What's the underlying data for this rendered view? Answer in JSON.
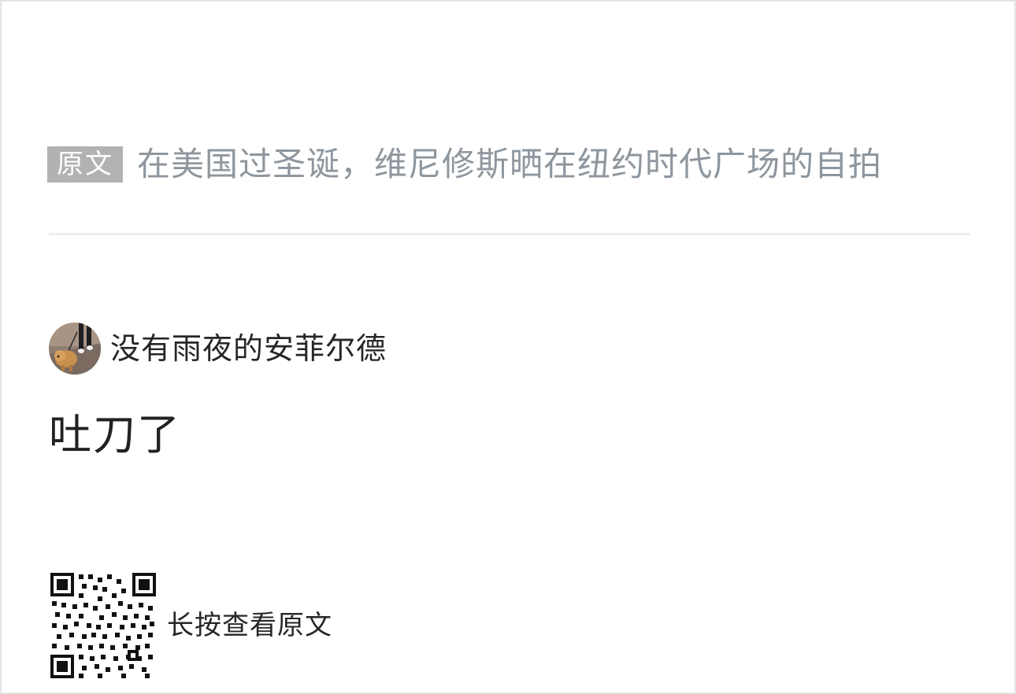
{
  "original": {
    "badge_label": "原文",
    "title": "在美国过圣诞，维尼修斯晒在纽约时代广场的自拍"
  },
  "author": {
    "name": "没有雨夜的安菲尔德",
    "avatar_icon": "dog-photo-avatar"
  },
  "comment": {
    "text": "吐刀了"
  },
  "qr": {
    "icon": "qr-code-icon",
    "hint": "长按查看原文"
  },
  "colors": {
    "badge_bg": "#b2b2b2",
    "title_text": "#8e969e",
    "body_text": "#222222",
    "border": "#e4e4e6"
  }
}
